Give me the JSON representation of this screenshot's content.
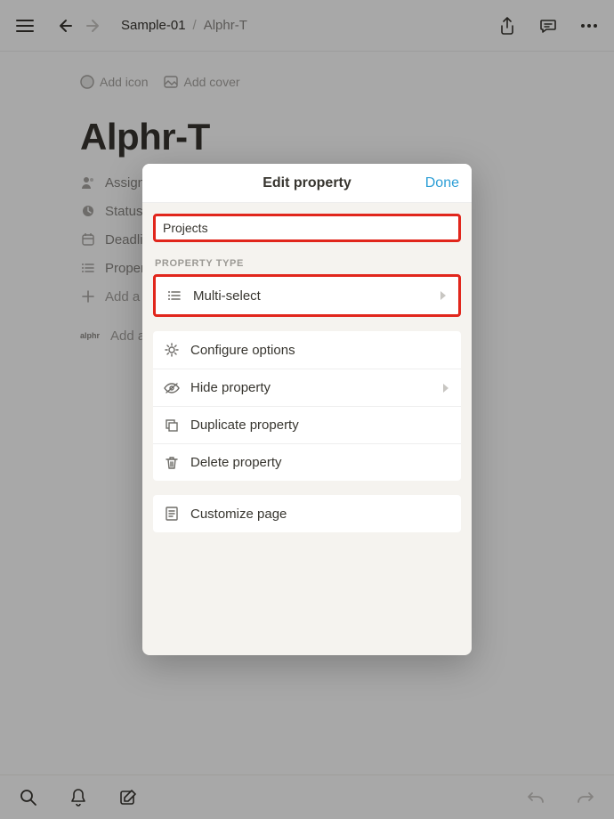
{
  "topbar": {
    "breadcrumb_root": "Sample-01",
    "breadcrumb_sep": "/",
    "breadcrumb_current": "Alphr-T"
  },
  "meta": {
    "add_icon": "Add icon",
    "add_cover": "Add cover"
  },
  "page": {
    "title": "Alphr-T"
  },
  "properties": {
    "assign": "Assign",
    "status": "Status",
    "deadline": "Deadline",
    "property": "Property",
    "add": "Add a property"
  },
  "comment": {
    "placeholder": "Add a comment…",
    "logo_text": "alphr"
  },
  "modal": {
    "title": "Edit property",
    "done": "Done",
    "name_value": "Projects",
    "section_type_label": "PROPERTY TYPE",
    "type_row": "Multi-select",
    "configure": "Configure options",
    "hide": "Hide property",
    "duplicate": "Duplicate property",
    "delete": "Delete property",
    "customize": "Customize page"
  }
}
